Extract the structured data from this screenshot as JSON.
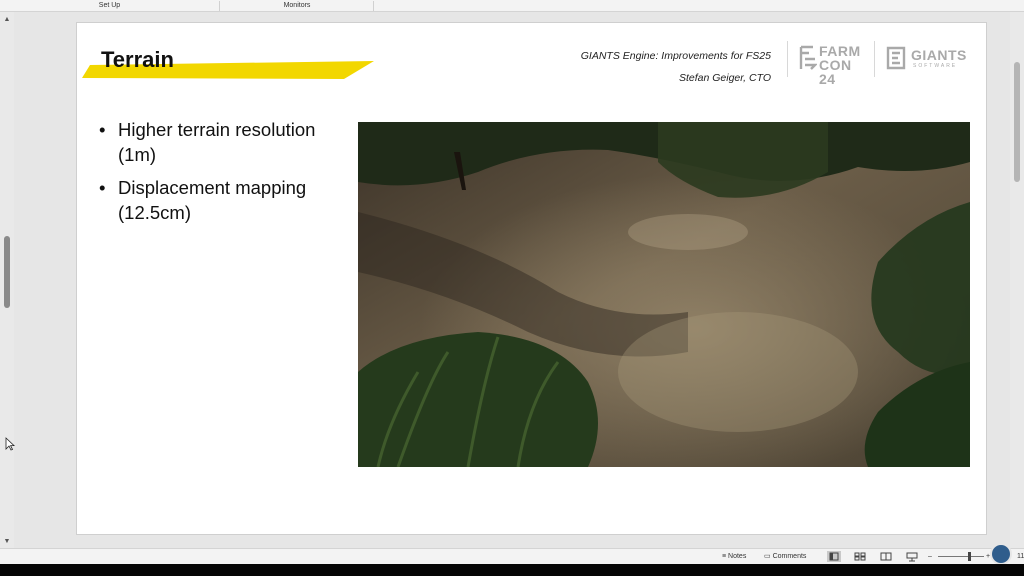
{
  "ribbon": {
    "groups": [
      "Set Up",
      "Monitors"
    ]
  },
  "slide": {
    "title": "Terrain",
    "accent_color": "#f2d700",
    "meta_line1": "GIANTS Engine: Improvements for FS25",
    "meta_line2": "Stefan Geiger, CTO",
    "logo_farmcon_line1": "FARM",
    "logo_farmcon_line2": "CON 24",
    "logo_giants": "GIANTS",
    "logo_giants_sub": "SOFTWARE",
    "bullets": [
      "Higher terrain resolution (1m)",
      "Displacement mapping (12.5cm)"
    ],
    "image_icon": "terrain-screenshot-image"
  },
  "status": {
    "notes": "Notes",
    "comments": "Comments",
    "zoom": "11"
  },
  "icons": {
    "scroll_up": "chevron-up-icon",
    "scroll_down": "chevron-down-icon",
    "cursor": "arrow-cursor-icon"
  }
}
